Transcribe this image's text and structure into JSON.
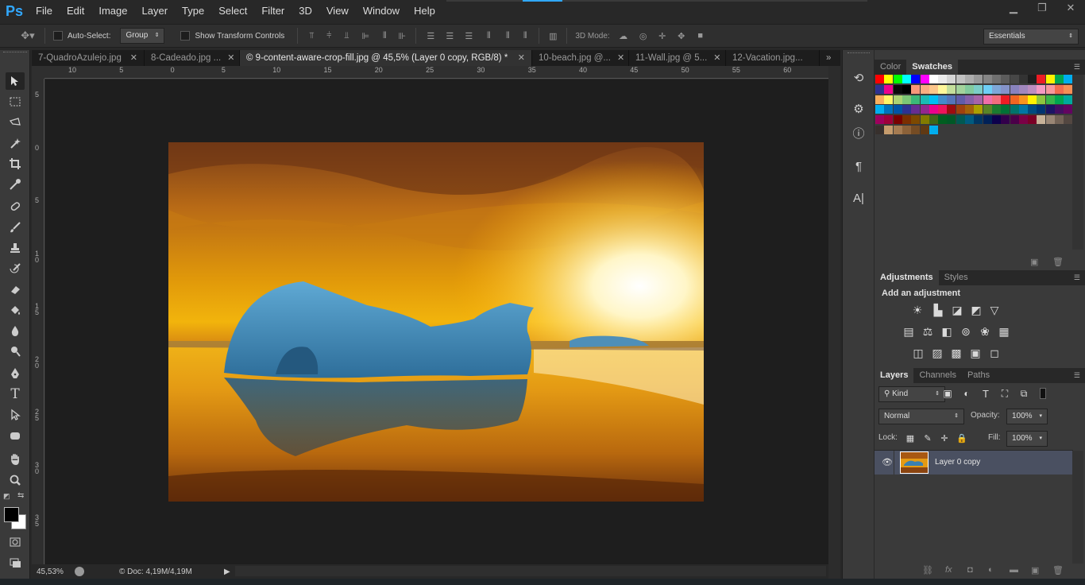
{
  "app": {
    "logo": "Ps"
  },
  "menu": [
    "File",
    "Edit",
    "Image",
    "Layer",
    "Type",
    "Select",
    "Filter",
    "3D",
    "View",
    "Window",
    "Help"
  ],
  "window_controls": {
    "minimize": "▁",
    "restore": "❐",
    "close": "✕"
  },
  "options": {
    "auto_select_label": "Auto-Select:",
    "auto_select_value": "Group",
    "show_transform_label": "Show Transform Controls",
    "mode_3d_label": "3D Mode:",
    "workspace": "Essentials"
  },
  "tabs": [
    {
      "label": "7-QuadroAzulejo.jpg",
      "active": false
    },
    {
      "label": "8-Cadeado.jpg ...",
      "active": false
    },
    {
      "label": "© 9-content-aware-crop-fill.jpg @ 45,5% (Layer 0 copy, RGB/8) *",
      "active": true
    },
    {
      "label": "10-beach.jpg @...",
      "active": false
    },
    {
      "label": "11-Wall.jpg @ 5...",
      "active": false
    },
    {
      "label": "12-Vacation.jpg...",
      "active": false
    }
  ],
  "ruler_h": [
    "10",
    "5",
    "0",
    "5",
    "10",
    "15",
    "20",
    "25",
    "30",
    "35",
    "40",
    "45",
    "50",
    "55",
    "60"
  ],
  "ruler_v": [
    "5",
    "0",
    "5",
    "1\n0",
    "1\n5",
    "2\n0",
    "2\n5",
    "3\n0",
    "3\n5"
  ],
  "status": {
    "zoom": "45,53%",
    "doc": "© Doc: 4,19M/4,19M"
  },
  "swatches_panel": {
    "tabs": [
      "Color",
      "Swatches"
    ],
    "active": "Swatches"
  },
  "adjustments_panel": {
    "tabs": [
      "Adjustments",
      "Styles"
    ],
    "active": "Adjustments",
    "heading": "Add an adjustment"
  },
  "layers_panel": {
    "tabs": [
      "Layers",
      "Channels",
      "Paths"
    ],
    "active": "Layers",
    "filter_kind": "Kind",
    "blend_mode": "Normal",
    "opacity_label": "Opacity:",
    "opacity_value": "100%",
    "lock_label": "Lock:",
    "fill_label": "Fill:",
    "fill_value": "100%",
    "layers": [
      {
        "name": "Layer 0 copy",
        "visible": true,
        "selected": true
      }
    ]
  },
  "colors": {
    "accent": "#31a8ff",
    "swatch_rows": [
      [
        "#ff0000",
        "#ffff00",
        "#00ff00",
        "#00ffff",
        "#0000ff",
        "#ff00ff",
        "#ffffff",
        "#ebebeb",
        "#d6d6d6",
        "#c2c2c2",
        "#adadad",
        "#999999",
        "#858585",
        "#707070",
        "#5c5c5c",
        "#474747",
        "#333333",
        "#1f1f1f",
        "#ed1c24",
        "#fff200",
        "#00a651",
        "#00aeef"
      ],
      [
        "#2e3192",
        "#ec008c",
        "#0a0a0a",
        "#000000",
        "#f7977a",
        "#f9ad81",
        "#fdc68a",
        "#fff79a",
        "#c4df9b",
        "#a3d39c",
        "#82ca9d",
        "#7bcdc8",
        "#6ecff6",
        "#7ea7d8",
        "#8493ca",
        "#8882be",
        "#a187be",
        "#bc8dbf",
        "#f49ac2",
        "#f6989d",
        "#f26c4f",
        "#f68e55"
      ],
      [
        "#fbaf5c",
        "#fff467",
        "#acd372",
        "#7cc576",
        "#3bb878",
        "#1abbb4",
        "#00bff3",
        "#438cca",
        "#5574b9",
        "#605ca8",
        "#855fa8",
        "#a763a8",
        "#f06ea9",
        "#f26d7d",
        "#ed1c24",
        "#f26522",
        "#f7941d",
        "#fff200",
        "#8dc63f",
        "#39b54a",
        "#00a651",
        "#00a99d"
      ],
      [
        "#00aeef",
        "#0072bc",
        "#0054a6",
        "#2e3192",
        "#662d91",
        "#92278f",
        "#ec008c",
        "#ed145b",
        "#9e0b0f",
        "#a0410d",
        "#a36209",
        "#aba000",
        "#598527",
        "#1a7b30",
        "#007236",
        "#00746b",
        "#0076a3",
        "#004b80",
        "#003471",
        "#1b1464",
        "#440e62",
        "#630460"
      ],
      [
        "#9e005d",
        "#9e0039",
        "#790000",
        "#7b2e00",
        "#7d4900",
        "#827b00",
        "#406618",
        "#005e20",
        "#005826",
        "#005952",
        "#005b7f",
        "#003663",
        "#002157",
        "#0d004c",
        "#32004b",
        "#4b0049",
        "#7b0046",
        "#7a0026",
        "#c7b299",
        "#998675",
        "#736357",
        "#534741"
      ],
      [
        "#37302d",
        "#c69c6d",
        "#a67c52",
        "#8c6239",
        "#754c24",
        "#603913",
        "#00aeef"
      ]
    ]
  }
}
